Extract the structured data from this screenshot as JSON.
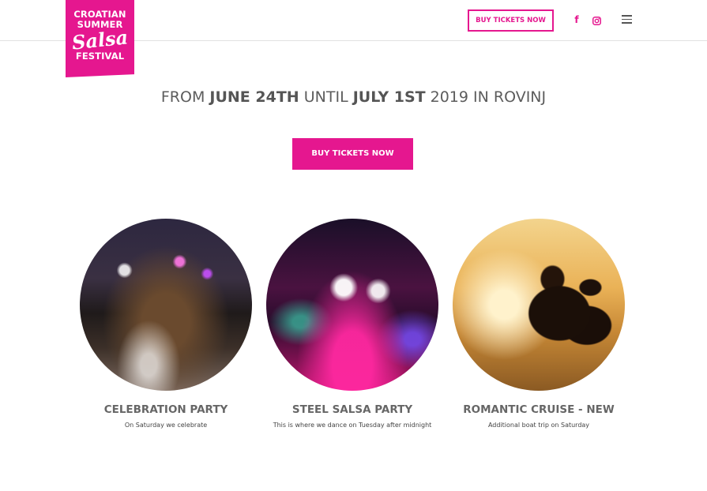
{
  "logo": {
    "line1": "CROATIAN",
    "line2": "SUMMER",
    "line3": "Salsa",
    "line4": "FESTIVAL"
  },
  "header": {
    "ticket_button_label": "BUY TICKETS NOW",
    "facebook_icon": "f",
    "instagram_icon": "instagram-icon",
    "menu_icon": "hamburger-menu-icon"
  },
  "hero": {
    "headline_prefix": "FROM ",
    "date_start": "JUNE 24TH",
    "headline_middle": " UNTIL ",
    "date_end": "JULY 1ST",
    "headline_suffix": " 2019 IN ROVINJ",
    "cta_label": "BUY TICKETS NOW"
  },
  "events": [
    {
      "title": "CELEBRATION PARTY",
      "subtitle": "On Saturday we celebrate"
    },
    {
      "title": "STEEL SALSA PARTY",
      "subtitle": "This is where we dance on Tuesday after midnight"
    },
    {
      "title": "ROMANTIC CRUISE - NEW",
      "subtitle": "Additional boat trip on Saturday"
    }
  ],
  "colors": {
    "brand": "#e5178f",
    "heading_text": "#5c5c5c",
    "card_title": "#666666"
  }
}
